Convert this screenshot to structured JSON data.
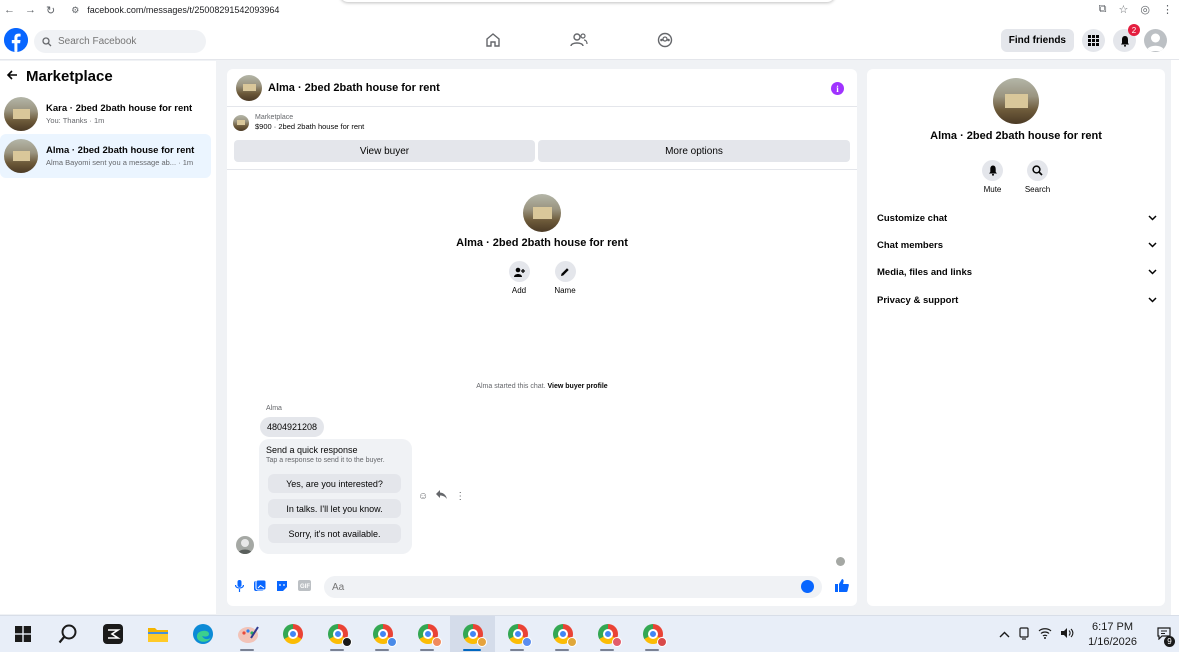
{
  "browser": {
    "url": "facebook.com/messages/t/25008291542093964"
  },
  "header": {
    "search_placeholder": "Search Facebook",
    "find_friends_label": "Find friends",
    "notification_count": "2"
  },
  "sidebar": {
    "title": "Marketplace",
    "conversations": [
      {
        "title": "Kara · 2bed 2bath house for rent",
        "subtitle": "You: Thanks · 1m"
      },
      {
        "title": "Alma · 2bed 2bath house for rent",
        "subtitle": "Alma Bayomi sent you a message ab... · 1m"
      }
    ]
  },
  "chat": {
    "title": "Alma · 2bed 2bath house for rent",
    "marketplace_label": "Marketplace",
    "listing_detail": "$900 · 2bed 2bath house for rent",
    "view_buyer_label": "View buyer",
    "more_options_label": "More options",
    "group_title": "Alma · 2bed 2bath house for rent",
    "add_label": "Add",
    "name_label": "Name",
    "started_text": "Alma started this chat.",
    "view_profile_label": "View buyer profile",
    "sender_name": "Alma",
    "phone_message": "4804921208",
    "quick_title": "Send a quick response",
    "quick_subtitle": "Tap a response to send it to the buyer.",
    "quick_responses": [
      "Yes, are you interested?",
      "In talks. I'll let you know.",
      "Sorry, it's not available."
    ],
    "composer_placeholder": "Aa"
  },
  "right_panel": {
    "title": "Alma · 2bed 2bath house for rent",
    "mute_label": "Mute",
    "search_label": "Search",
    "sections": [
      "Customize chat",
      "Chat members",
      "Media, files and links",
      "Privacy & support"
    ]
  },
  "taskbar": {
    "time": "6:17 PM",
    "date": "1/16/2026",
    "notification_count": "9"
  },
  "colors": {
    "brand_blue": "#0866ff",
    "info_purple": "#a033ff",
    "badge_red": "#e41e3f"
  }
}
